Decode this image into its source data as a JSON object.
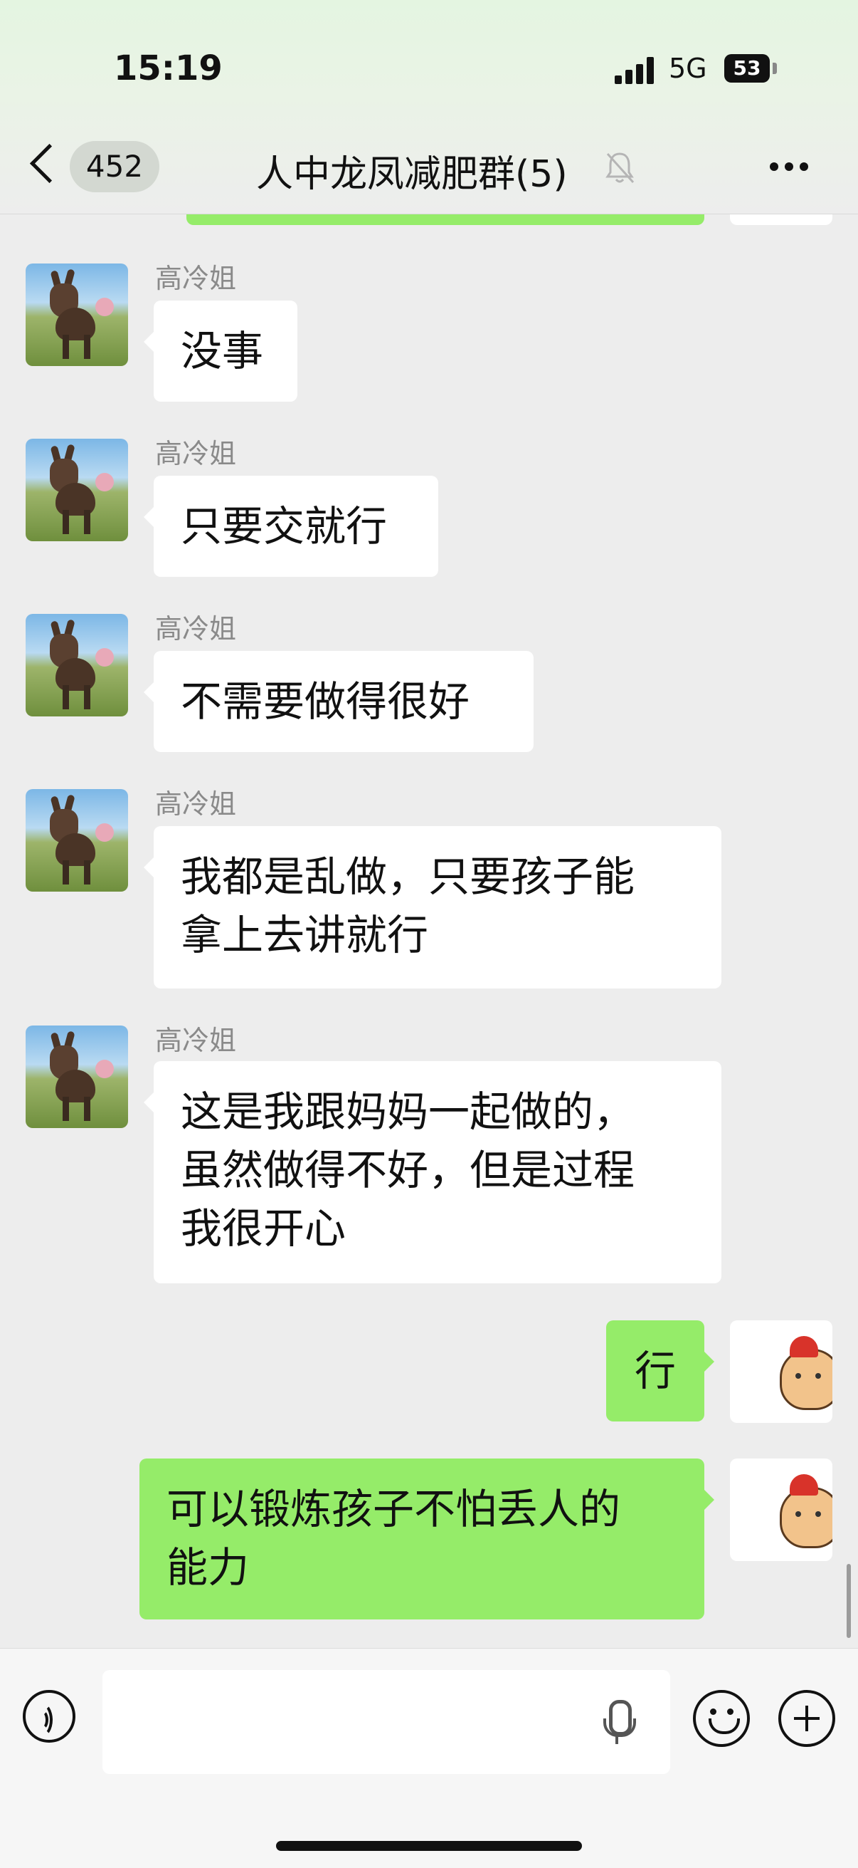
{
  "status_bar": {
    "time": "15:19",
    "network": "5G",
    "battery": "53"
  },
  "header": {
    "unread_count": "452",
    "title": "人中龙凤减肥群(5)"
  },
  "messages": [
    {
      "sender": "高冷姐",
      "text": "没事"
    },
    {
      "sender": "高冷姐",
      "text": "只要交就行"
    },
    {
      "sender": "高冷姐",
      "text": "不需要做得很好"
    },
    {
      "sender": "高冷姐",
      "lines": [
        "我都是乱做，只要孩子能",
        "拿上去讲就行"
      ]
    },
    {
      "sender": "高冷姐",
      "lines": [
        "这是我跟妈妈一起做的，",
        "虽然做得不好，但是过程",
        "我很开心"
      ]
    }
  ],
  "my_messages": [
    {
      "text": "行"
    },
    {
      "lines": [
        "可以锻炼孩子不怕丢人的",
        "能力"
      ]
    }
  ],
  "colors": {
    "outgoing_bubble": "#95ec69",
    "incoming_bubble": "#ffffff",
    "background": "#ededed"
  },
  "icons": [
    "back-chevron-icon",
    "mute-bell-icon",
    "more-icon",
    "voice-icon",
    "mic-icon",
    "emoji-icon",
    "plus-icon"
  ]
}
